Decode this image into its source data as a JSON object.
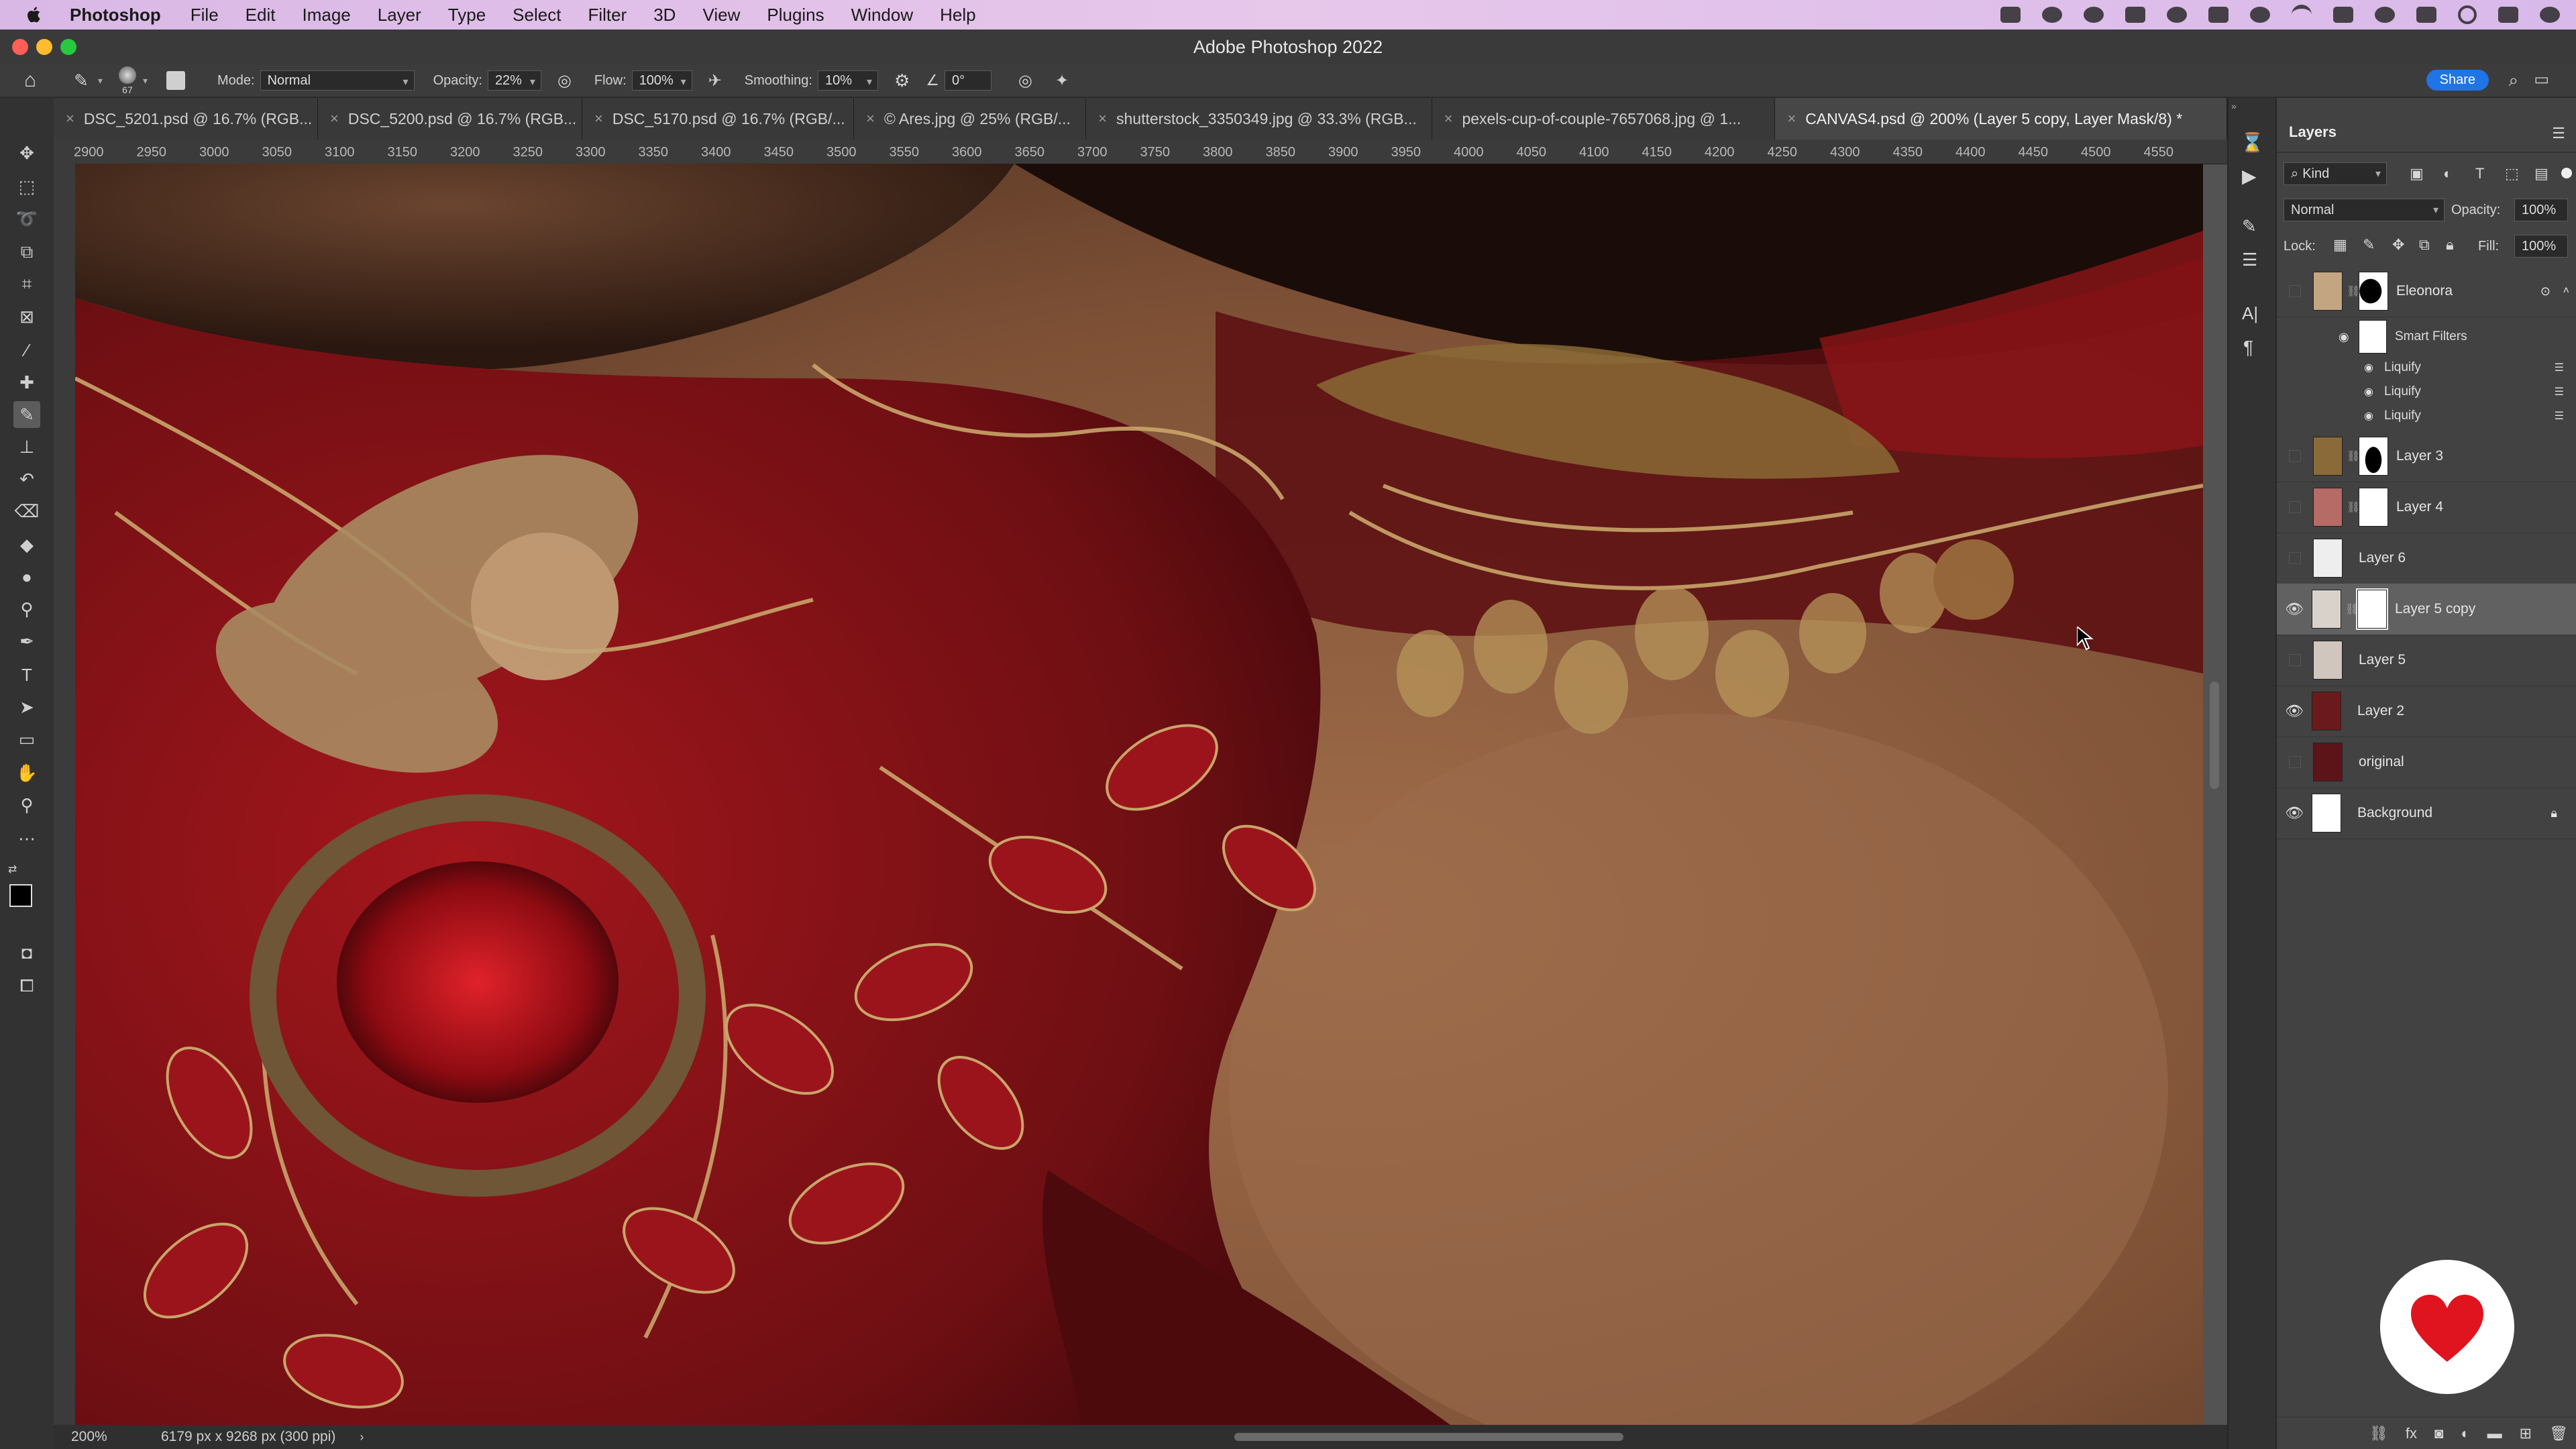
{
  "menubar": {
    "app": "Photoshop",
    "items": [
      "File",
      "Edit",
      "Image",
      "Layer",
      "Type",
      "Select",
      "Filter",
      "3D",
      "View",
      "Plugins",
      "Window",
      "Help"
    ]
  },
  "window": {
    "title": "Adobe Photoshop 2022"
  },
  "options": {
    "brush_size": "67",
    "mode_label": "Mode:",
    "mode_value": "Normal",
    "opacity_label": "Opacity:",
    "opacity_value": "22%",
    "flow_label": "Flow:",
    "flow_value": "100%",
    "smoothing_label": "Smoothing:",
    "smoothing_value": "10%",
    "angle_value": "0°",
    "share_label": "Share"
  },
  "tabs": [
    {
      "label": "DSC_5201.psd @ 16.7% (RGB..."
    },
    {
      "label": "DSC_5200.psd @ 16.7% (RGB..."
    },
    {
      "label": "DSC_5170.psd @ 16.7% (RGB/..."
    },
    {
      "label": "© Ares.jpg @ 25% (RGB/..."
    },
    {
      "label": "shutterstock_3350349.jpg @ 33.3% (RGB..."
    },
    {
      "label": "pexels-cup-of-couple-7657068.jpg @ 1..."
    },
    {
      "label": "CANVAS4.psd @ 200% (Layer 5 copy, Layer Mask/8) *"
    }
  ],
  "ruler": {
    "ticks": [
      "2900",
      "2950",
      "3000",
      "3050",
      "3100",
      "3150",
      "3200",
      "3250",
      "3300",
      "3350",
      "3400",
      "3450",
      "3500",
      "3550",
      "3600",
      "3650",
      "3700",
      "3750",
      "3800",
      "3850",
      "3900",
      "3950",
      "4000",
      "4050",
      "4100",
      "4150",
      "4200",
      "4250",
      "4300",
      "4350",
      "4400",
      "4450",
      "4500",
      "4550"
    ]
  },
  "status": {
    "zoom": "200%",
    "doc_info": "6179 px x 9268 px (300 ppi)"
  },
  "layers_panel": {
    "title": "Layers",
    "filter_kind": "Kind",
    "blend_mode": "Normal",
    "opacity_label": "Opacity:",
    "opacity_value": "100%",
    "lock_label": "Lock:",
    "fill_label": "Fill:",
    "fill_value": "100%",
    "layers": [
      {
        "name": "Eleonora",
        "visible": false,
        "has_mask": true
      },
      {
        "name": "Layer 3",
        "visible": false,
        "has_mask": true
      },
      {
        "name": "Layer 4",
        "visible": false,
        "has_mask": true
      },
      {
        "name": "Layer 6",
        "visible": false,
        "has_mask": false
      },
      {
        "name": "Layer 5 copy",
        "visible": true,
        "has_mask": true,
        "selected": true
      },
      {
        "name": "Layer 5",
        "visible": false,
        "has_mask": false
      },
      {
        "name": "Layer 2",
        "visible": true,
        "has_mask": false
      },
      {
        "name": "original",
        "visible": false,
        "has_mask": false
      },
      {
        "name": "Background",
        "visible": true,
        "has_mask": false,
        "locked": true
      }
    ],
    "smart_filters": {
      "label": "Smart Filters",
      "items": [
        "Liquify",
        "Liquify",
        "Liquify"
      ]
    }
  },
  "colors": {
    "accent": "#1f74e6",
    "skin": "#8a5a3c",
    "fabric_red": "#8c1418",
    "gold": "#b8955a"
  }
}
